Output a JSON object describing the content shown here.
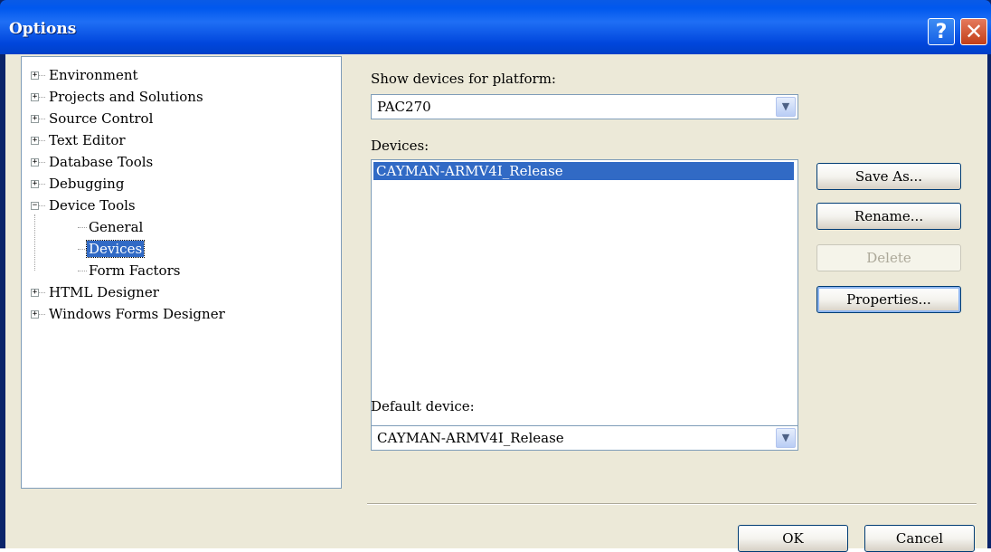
{
  "window": {
    "title": "Options"
  },
  "titlebar": {
    "help_glyph": "?",
    "close_glyph": "✕"
  },
  "tree": {
    "items": [
      {
        "label": "Environment",
        "expander": "+"
      },
      {
        "label": "Projects and Solutions",
        "expander": "+"
      },
      {
        "label": "Source Control",
        "expander": "+"
      },
      {
        "label": "Text Editor",
        "expander": "+"
      },
      {
        "label": "Database Tools",
        "expander": "+"
      },
      {
        "label": "Debugging",
        "expander": "+"
      },
      {
        "label": "Device Tools",
        "expander": "−"
      },
      {
        "label": "General"
      },
      {
        "label": "Devices",
        "selected": true
      },
      {
        "label": "Form Factors"
      },
      {
        "label": "HTML Designer",
        "expander": "+"
      },
      {
        "label": "Windows Forms Designer",
        "expander": "+"
      }
    ]
  },
  "platform": {
    "label": "Show devices for platform:",
    "value": "PAC270"
  },
  "devices": {
    "label": "Devices:",
    "items": [
      "CAYMAN-ARMV4I_Release"
    ]
  },
  "buttons": {
    "save_as": "Save As...",
    "rename": "Rename...",
    "delete": "Delete",
    "properties": "Properties..."
  },
  "default_device": {
    "label": "Default device:",
    "value": "CAYMAN-ARMV4I_Release"
  },
  "footer": {
    "ok": "OK",
    "cancel": "Cancel"
  },
  "icons": {
    "combo_arrow": "▼"
  },
  "colors": {
    "titlebar": "#0058ee",
    "selection": "#316ac5",
    "dialog_bg": "#ece9d8"
  }
}
